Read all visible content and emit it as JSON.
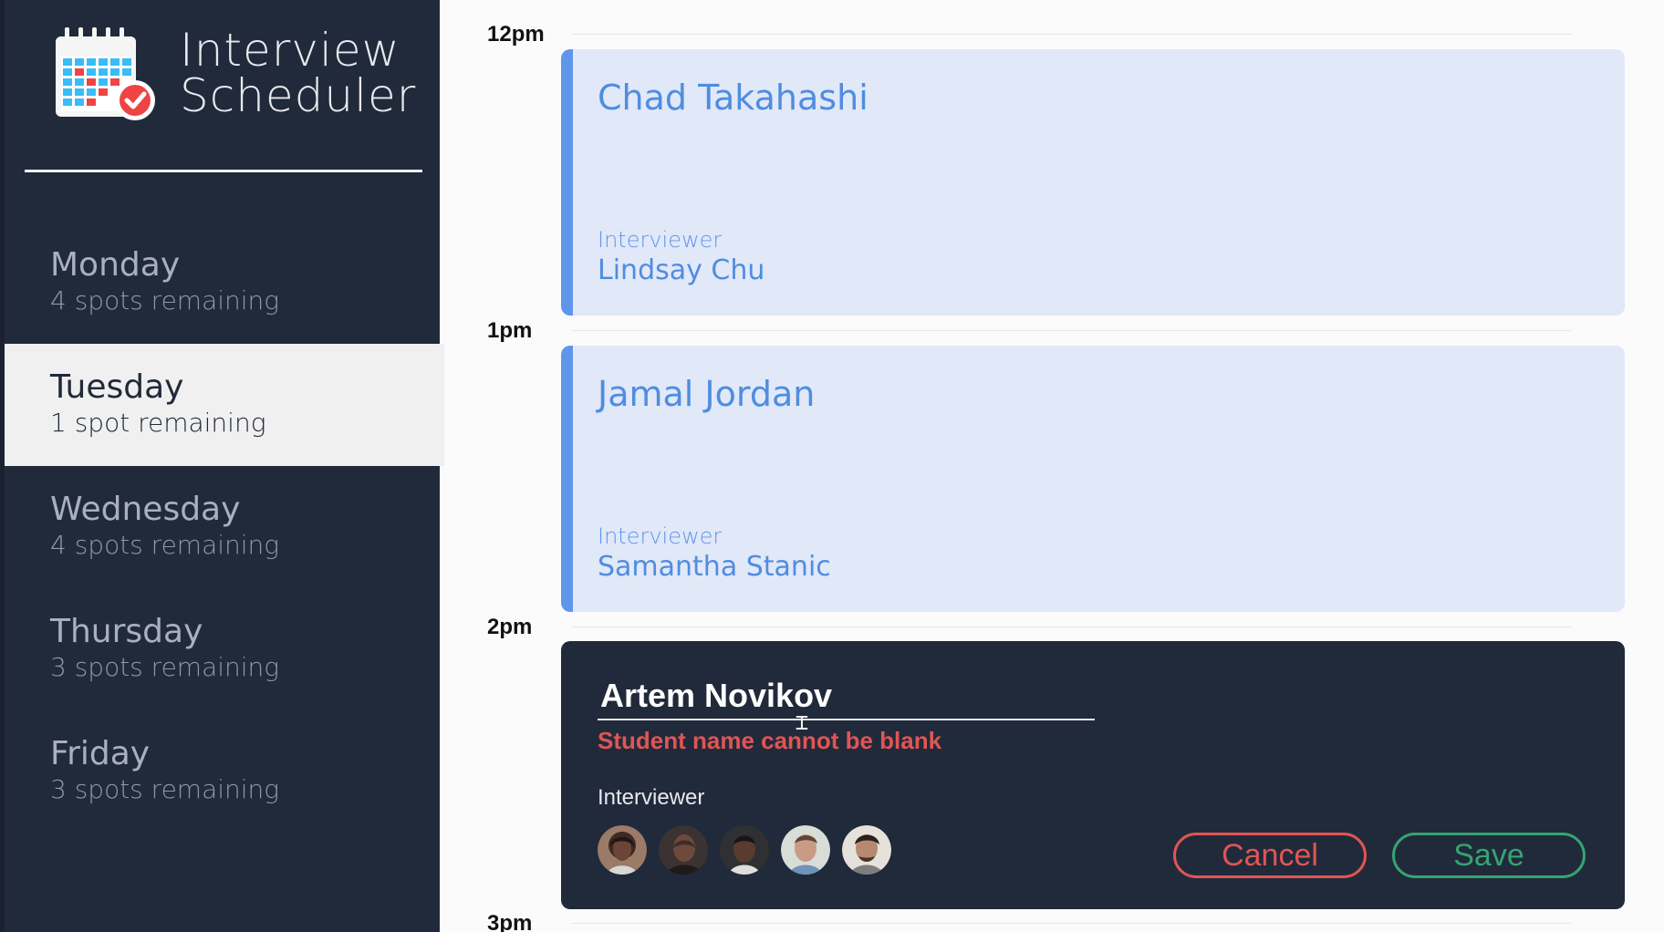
{
  "app": {
    "title_line_1": "Interview",
    "title_line_2": "Scheduler"
  },
  "sidebar": {
    "days": [
      {
        "name": "Monday",
        "spots": "4 spots remaining",
        "selected": false
      },
      {
        "name": "Tuesday",
        "spots": "1 spot remaining",
        "selected": true
      },
      {
        "name": "Wednesday",
        "spots": "4 spots remaining",
        "selected": false
      },
      {
        "name": "Thursday",
        "spots": "3 spots remaining",
        "selected": false
      },
      {
        "name": "Friday",
        "spots": "3 spots remaining",
        "selected": false
      }
    ]
  },
  "schedule": {
    "hours": [
      "12pm",
      "1pm",
      "2pm",
      "3pm"
    ],
    "appointments": [
      {
        "student": "Chad Takahashi",
        "interviewer_label": "Interviewer",
        "interviewer": "Lindsay Chu"
      },
      {
        "student": "Jamal Jordan",
        "interviewer_label": "Interviewer",
        "interviewer": "Samantha Stanic"
      }
    ],
    "editor": {
      "student_value": "Artem Novikov",
      "error": "Student name cannot be blank",
      "interviewer_label": "Interviewer",
      "cancel_label": "Cancel",
      "save_label": "Save",
      "cursor_icon": "text-cursor-icon"
    }
  },
  "colors": {
    "sidebar": "#212a3a",
    "appointment_bg": "#e1e8f8",
    "appointment_accent": "#5f96ec",
    "danger": "#e05555",
    "success": "#36a372"
  }
}
